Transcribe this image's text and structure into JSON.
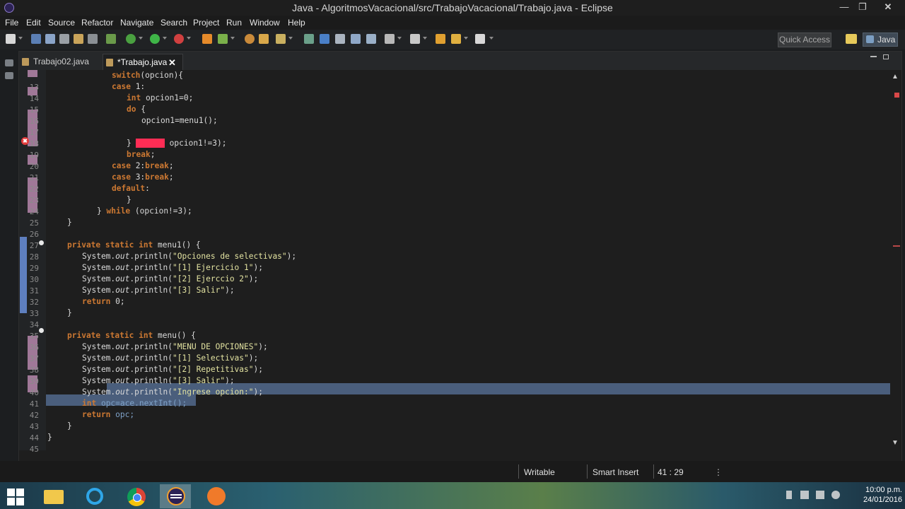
{
  "window": {
    "title": "Java - AlgoritmosVacacional/src/TrabajoVacacional/Trabajo.java - Eclipse",
    "minimize_glyph": "—",
    "maximize_glyph": "❐",
    "close_glyph": "✕"
  },
  "menu": [
    "File",
    "Edit",
    "Source",
    "Refactor",
    "Navigate",
    "Search",
    "Project",
    "Run",
    "Window",
    "Help"
  ],
  "toolbar": {
    "quick_access_placeholder": "Quick Access",
    "perspective": "Java"
  },
  "tabs": [
    {
      "label": "Trabajo02.java",
      "active": false
    },
    {
      "label": "*Trabajo.java",
      "active": true,
      "close_glyph": "✕"
    }
  ],
  "editor": {
    "lines": [
      {
        "n": "",
        "text": "switch(opcion){"
      },
      {
        "n": "13",
        "text": "case 1:"
      },
      {
        "n": "14",
        "text": "int opcion1=0;"
      },
      {
        "n": "15",
        "text": "do {"
      },
      {
        "n": "16",
        "text": "opcion1=menu1();"
      },
      {
        "n": "17",
        "text": ""
      },
      {
        "n": "18",
        "text": "} while( opcion1!=3);"
      },
      {
        "n": "19",
        "text": "break;"
      },
      {
        "n": "20",
        "text": "case 2:break;"
      },
      {
        "n": "21",
        "text": "case 3:break;"
      },
      {
        "n": "22",
        "text": "default:"
      },
      {
        "n": "23",
        "text": "}"
      },
      {
        "n": "24",
        "text": "} while (opcion!=3);"
      },
      {
        "n": "25",
        "text": "}"
      },
      {
        "n": "26",
        "text": ""
      },
      {
        "n": "27",
        "text": "private static int menu1() {"
      },
      {
        "n": "28",
        "text": "System.out.println(\"Opciones de selectivas\");"
      },
      {
        "n": "29",
        "text": "System.out.println(\"[1] Ejercicio 1\");"
      },
      {
        "n": "30",
        "text": "System.out.println(\"[2] Ejerccio 2\");"
      },
      {
        "n": "31",
        "text": "System.out.println(\"[3] Salir\");"
      },
      {
        "n": "32",
        "text": "return 0;"
      },
      {
        "n": "33",
        "text": "}"
      },
      {
        "n": "34",
        "text": ""
      },
      {
        "n": "35",
        "text": "private static int menu() {"
      },
      {
        "n": "36",
        "text": "System.out.println(\"MENU DE OPCIONES\");"
      },
      {
        "n": "37",
        "text": "System.out.println(\"[1] Selectivas\");"
      },
      {
        "n": "38",
        "text": "System.out.println(\"[2] Repetitivas\");"
      },
      {
        "n": "39",
        "text": "System.out.println(\"[3] Salir\");"
      },
      {
        "n": "40",
        "text": "System.out.println(\"Ingrese opcion:\");"
      },
      {
        "n": "41",
        "text": "int opc=ace.nextInt();"
      },
      {
        "n": "42",
        "text": "return opc;"
      },
      {
        "n": "43",
        "text": "}"
      },
      {
        "n": "44",
        "text": "}"
      },
      {
        "n": "45",
        "text": ""
      }
    ]
  },
  "status": {
    "writable": "Writable",
    "insert_mode": "Smart Insert",
    "position": "41 : 29"
  },
  "taskbar": {
    "time": "10:00 p.m.",
    "date": "24/01/2016"
  },
  "colors": {
    "keyword": "#cc7832",
    "string": "#e2e2a0",
    "selection": "#4a5e7c",
    "error": "#ff2d55"
  }
}
